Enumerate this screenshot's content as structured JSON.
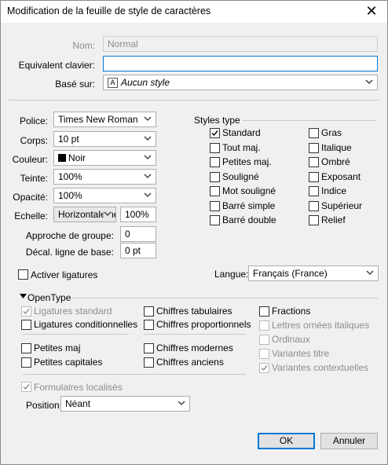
{
  "window": {
    "title": "Modification de la feuille de style de caractères"
  },
  "general": {
    "nom_label": "Nom:",
    "nom_value": "Normal",
    "equivalent_label": "Equivalent clavier:",
    "equivalent_value": "",
    "base_label": "Basé sur:",
    "base_value": "Aucun style"
  },
  "format": {
    "police_label": "Police:",
    "police_value": "Times New Roman",
    "corps_label": "Corps:",
    "corps_value": "10 pt",
    "couleur_label": "Couleur:",
    "couleur_value": "Noir",
    "teinte_label": "Teinte:",
    "teinte_value": "100%",
    "opacite_label": "Opacité:",
    "opacite_value": "100%",
    "echelle_label": "Echelle:",
    "echelle_mode": "Horizontalement",
    "echelle_value": "100%",
    "approche_label": "Approche de groupe:",
    "approche_value": "0",
    "decal_label": "Décal. ligne de base:",
    "decal_value": "0 pt"
  },
  "styles": {
    "heading": "Styles type",
    "items": [
      {
        "label": "Standard",
        "checked": true
      },
      {
        "label": "Gras",
        "checked": false
      },
      {
        "label": "Tout maj.",
        "checked": false
      },
      {
        "label": "Italique",
        "checked": false
      },
      {
        "label": "Petites maj.",
        "checked": false
      },
      {
        "label": "Ombré",
        "checked": false
      },
      {
        "label": "Souligné",
        "checked": false
      },
      {
        "label": "Exposant",
        "checked": false
      },
      {
        "label": "Mot souligné",
        "checked": false
      },
      {
        "label": "Indice",
        "checked": false
      },
      {
        "label": "Barré simple",
        "checked": false
      },
      {
        "label": "Supérieur",
        "checked": false
      },
      {
        "label": "Barré double",
        "checked": false
      },
      {
        "label": "Relief",
        "checked": false
      }
    ]
  },
  "ligatures": {
    "label": "Activer ligatures",
    "checked": false
  },
  "langue": {
    "label": "Langue:",
    "value": "Français (France)"
  },
  "opentype": {
    "heading": "OpenType",
    "col1": [
      {
        "label": "Ligatures standard",
        "checked": true,
        "disabled": true
      },
      {
        "label": "Ligatures conditionnelles",
        "checked": false,
        "disabled": false
      },
      {
        "label": "Petites maj",
        "checked": false,
        "disabled": false
      },
      {
        "label": "Petites capitales",
        "checked": false,
        "disabled": false
      }
    ],
    "col2": [
      {
        "label": "Chiffres tabulaires",
        "checked": false,
        "disabled": false
      },
      {
        "label": "Chiffres proportionnels",
        "checked": false,
        "disabled": false
      },
      {
        "label": "Chiffres modernes",
        "checked": false,
        "disabled": false
      },
      {
        "label": "Chiffres anciens",
        "checked": false,
        "disabled": false
      }
    ],
    "col3": [
      {
        "label": "Fractions",
        "checked": false,
        "disabled": false
      },
      {
        "label": "Lettres ornées italiques",
        "checked": false,
        "disabled": true
      },
      {
        "label": "Ordinaux",
        "checked": false,
        "disabled": true
      },
      {
        "label": "Variantes titre",
        "checked": false,
        "disabled": true
      },
      {
        "label": "Variantes contextuelles",
        "checked": true,
        "disabled": true
      }
    ],
    "formulaires": {
      "label": "Formulaires localisés",
      "checked": true,
      "disabled": true
    },
    "position_label": "Position:",
    "position_value": "Néant"
  },
  "buttons": {
    "ok": "OK",
    "cancel": "Annuler"
  }
}
